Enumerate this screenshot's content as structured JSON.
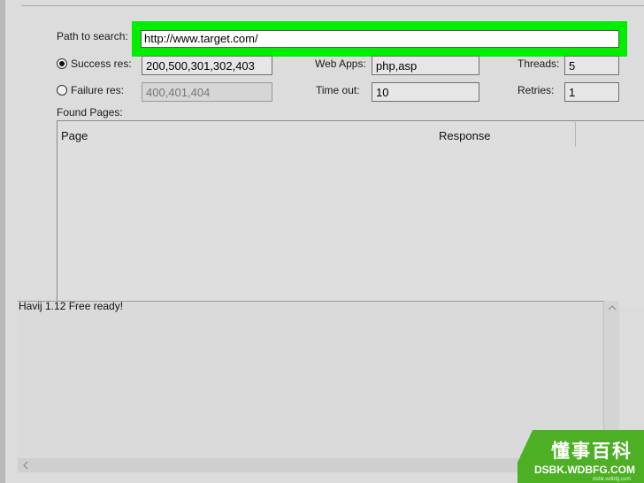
{
  "form": {
    "path_label": "Path to search:",
    "path_value": "http://www.target.com/",
    "success_label": "Success res:",
    "success_value": "200,500,301,302,403",
    "failure_label": "Failure res:",
    "failure_value": "400,401,404",
    "webapps_label": "Web Apps:",
    "webapps_value": "php,asp",
    "timeout_label": "Time out:",
    "timeout_value": "10",
    "threads_label": "Threads:",
    "threads_value": "5",
    "retries_label": "Retries:",
    "retries_value": "1",
    "selected_result_mode": "success"
  },
  "found_pages": {
    "label": "Found Pages:",
    "columns": [
      "Page",
      "Response"
    ]
  },
  "log": {
    "text": "Havij 1.12 Free ready!"
  },
  "watermark": {
    "cn": "懂事百科",
    "en": "DSBK.WDBFG.COM",
    "small": "dsbk.wdbfg.com"
  },
  "colors": {
    "highlight": "#00ee00",
    "watermark_bg": "#4caf24"
  },
  "icons": {
    "scroll_up": "scroll-up-arrow-icon",
    "scroll_left": "scroll-left-arrow-icon"
  }
}
